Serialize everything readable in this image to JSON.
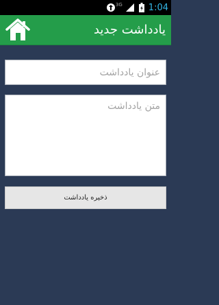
{
  "status_bar": {
    "network_label": "3G",
    "time": "1:04",
    "icons": [
      "notification-icon",
      "signal-icon",
      "battery-icon"
    ]
  },
  "header": {
    "title": "یادداشت جدید",
    "home_icon": "home-icon",
    "color": "#249d4a"
  },
  "form": {
    "title_placeholder": "عنوان یادداشت",
    "title_value": "",
    "body_placeholder": "متن یادداشت",
    "body_value": "",
    "save_label": "ذخیره یادداشت"
  },
  "colors": {
    "background": "#2b3a55",
    "header": "#249d4a",
    "time": "#33b5e5"
  }
}
